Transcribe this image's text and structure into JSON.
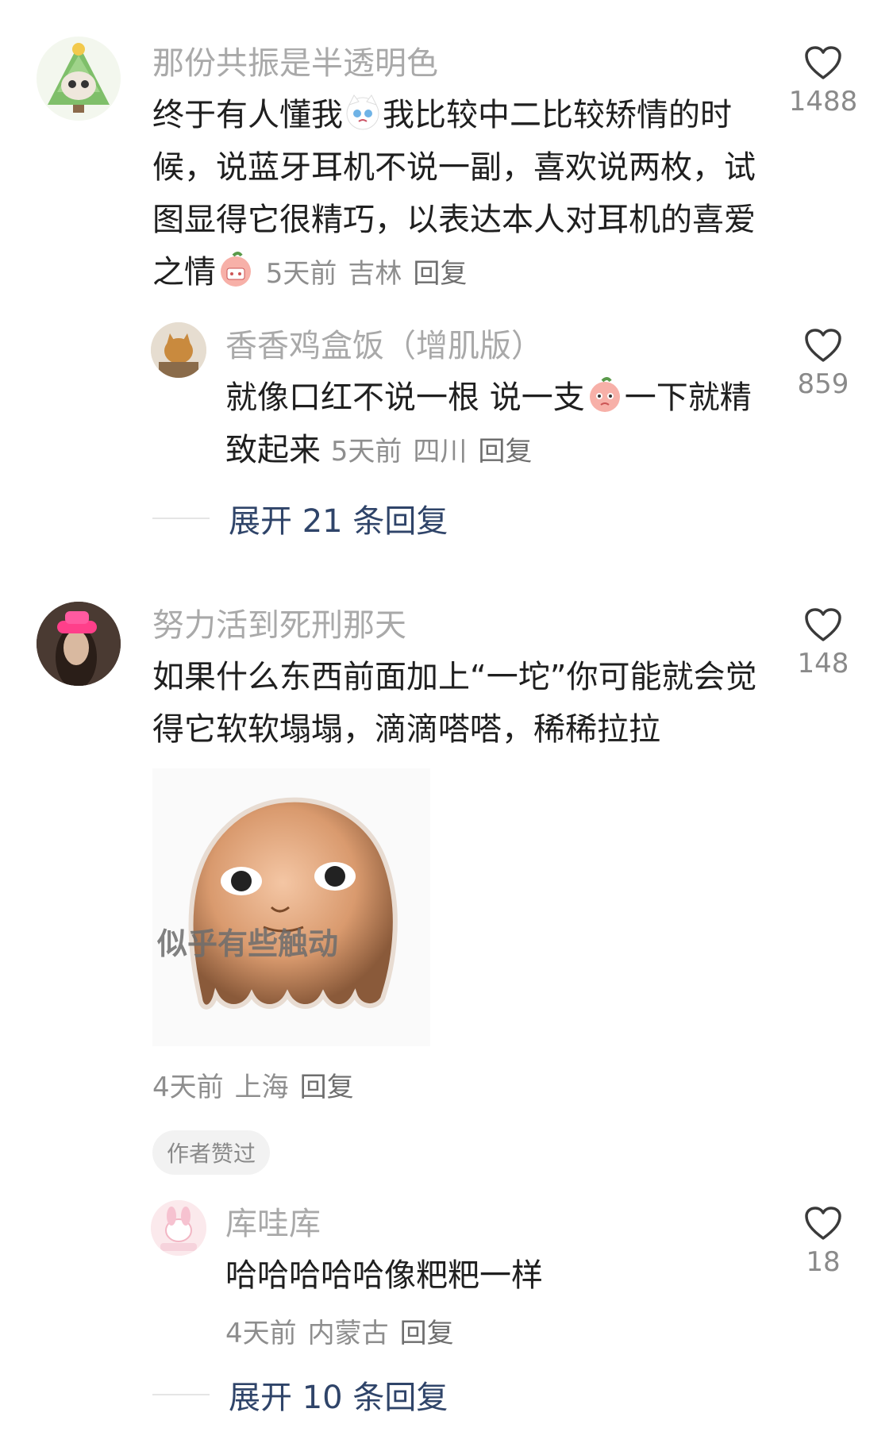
{
  "comments": [
    {
      "username": "那份共振是半透明色",
      "text_parts": [
        "终于有人懂我",
        "我比较中二比较矫情的时候，说蓝牙耳机不说一副，喜欢说两枚，试图显得它很精巧，以表达本人对耳机的喜爱之情"
      ],
      "time": "5天前",
      "location": "吉林",
      "reply_label": "回复",
      "likes": "1488",
      "replies": [
        {
          "username": "香香鸡盒饭（增肌版）",
          "text_parts": [
            "就像口红不说一根 说一支",
            "一下就精致起来"
          ],
          "time": "5天前",
          "location": "四川",
          "reply_label": "回复",
          "likes": "859"
        }
      ],
      "expand_label": "展开 21 条回复"
    },
    {
      "username": "努力活到死刑那天",
      "text": "如果什么东西前面加上“一坨”你可能就会觉得它软软塌塌，滴滴嗒嗒，稀稀拉拉",
      "sticker_caption": "似乎有些触动",
      "time": "4天前",
      "location": "上海",
      "reply_label": "回复",
      "likes": "148",
      "author_badge": "作者赞过",
      "replies": [
        {
          "username": "库哇库",
          "text": "哈哈哈哈哈像粑粑一样",
          "time": "4天前",
          "location": "内蒙古",
          "reply_label": "回复",
          "likes": "18"
        }
      ],
      "expand_label": "展开 10 条回复"
    }
  ],
  "icons": {
    "like": "heart-outline-icon",
    "emoji_cat": "crying-cat-emoji",
    "emoji_peach": "peach-emoji"
  },
  "colors": {
    "username": "#a9a9a9",
    "expand": "#2f4469",
    "meta": "#8e8e8e"
  }
}
